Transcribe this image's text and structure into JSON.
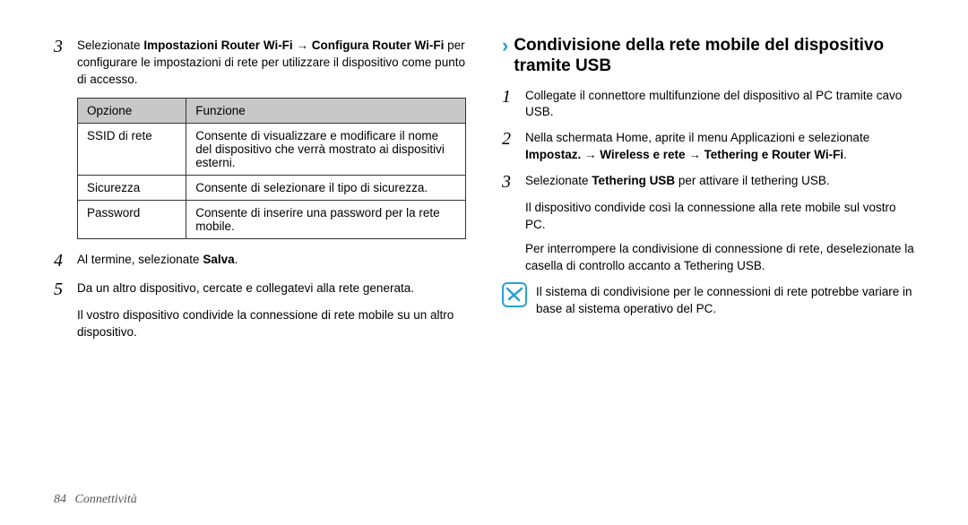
{
  "left": {
    "step3_pre": "Selezionate ",
    "step3_bold1": "Impostazioni Router Wi-Fi",
    "step3_arrow": " → ",
    "step3_bold2": "Configura Router Wi-Fi",
    "step3_post": " per configurare le impostazioni di rete per utilizzare il dispositivo come punto di accesso.",
    "table": {
      "h1": "Opzione",
      "h2": "Funzione",
      "r1c1": "SSID di rete",
      "r1c2": "Consente di visualizzare e modificare il nome del dispositivo che verrà mostrato ai dispositivi esterni.",
      "r2c1": "Sicurezza",
      "r2c2": "Consente di selezionare il tipo di sicurezza.",
      "r3c1": "Password",
      "r3c2": "Consente di inserire una password per la rete mobile."
    },
    "step4_pre": "Al termine, selezionate ",
    "step4_bold": "Salva",
    "step4_post": ".",
    "step5": "Da un altro dispositivo, cercate e collegatevi alla rete generata.",
    "step5_after": "Il vostro dispositivo condivide la connessione di rete mobile su un altro dispositivo."
  },
  "right": {
    "heading": "Condivisione della rete mobile del dispositivo tramite USB",
    "step1": "Collegate il connettore multifunzione del dispositivo al PC tramite cavo USB.",
    "step2_pre": "Nella schermata Home, aprite il menu Applicazioni e selezionate ",
    "step2_bold1": "Impostaz.",
    "step2_arrow1": " → ",
    "step2_bold2": "Wireless e rete",
    "step2_arrow2": " → ",
    "step2_bold3": "Tethering e Router Wi-Fi",
    "step2_post": ".",
    "step3_pre": "Selezionate ",
    "step3_bold": "Tethering USB",
    "step3_post": " per attivare il tethering USB.",
    "step3_after1": "Il dispositivo condivide così la connessione alla rete mobile sul vostro PC.",
    "step3_after2_pre": "Per interrompere la condivisione di connessione di rete, deselezionate la casella di controllo accanto a ",
    "step3_after2_bold": "Tethering USB",
    "step3_after2_post": ".",
    "note": "Il sistema di condivisione per le connessioni di rete potrebbe variare in base al sistema operativo del PC."
  },
  "footer": {
    "page": "84",
    "section": "Connettività"
  },
  "nums": {
    "n1": "1",
    "n2": "2",
    "n3": "3",
    "n4": "4",
    "n5": "5"
  }
}
